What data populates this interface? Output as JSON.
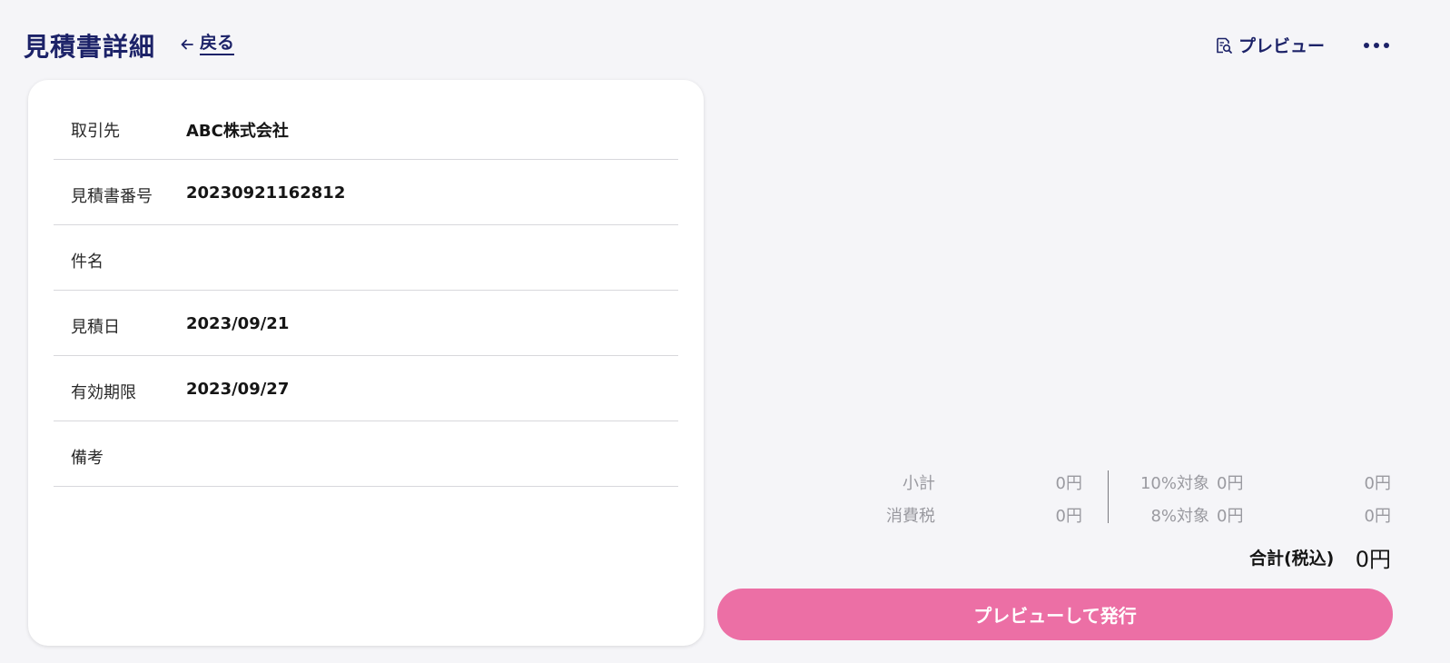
{
  "header": {
    "title": "見積書詳細",
    "back_label": "戻る",
    "preview_label": "プレビュー",
    "more_icon": "more-horizontal-icon"
  },
  "details": [
    {
      "label": "取引先",
      "value": "ABC株式会社"
    },
    {
      "label": "見積書番号",
      "value": "20230921162812"
    },
    {
      "label": "件名",
      "value": ""
    },
    {
      "label": "見積日",
      "value": "2023/09/21"
    },
    {
      "label": "有効期限",
      "value": "2023/09/27"
    },
    {
      "label": "備考",
      "value": ""
    }
  ],
  "summary": {
    "subtotal_label": "小計",
    "subtotal_value": "0円",
    "tax_label": "消費税",
    "tax_value": "0円",
    "rate10_label": "10%対象",
    "rate10_base": "0円",
    "rate10_tax": "0円",
    "rate8_label": "8%対象",
    "rate8_base": "0円",
    "rate8_tax": "0円",
    "total_label": "合計(税込)",
    "total_value": "0円"
  },
  "actions": {
    "issue_label": "プレビューして発行"
  },
  "colors": {
    "accent": "#1c2268",
    "issue_button": "#ec6fa5",
    "background": "#f5f5f8"
  }
}
